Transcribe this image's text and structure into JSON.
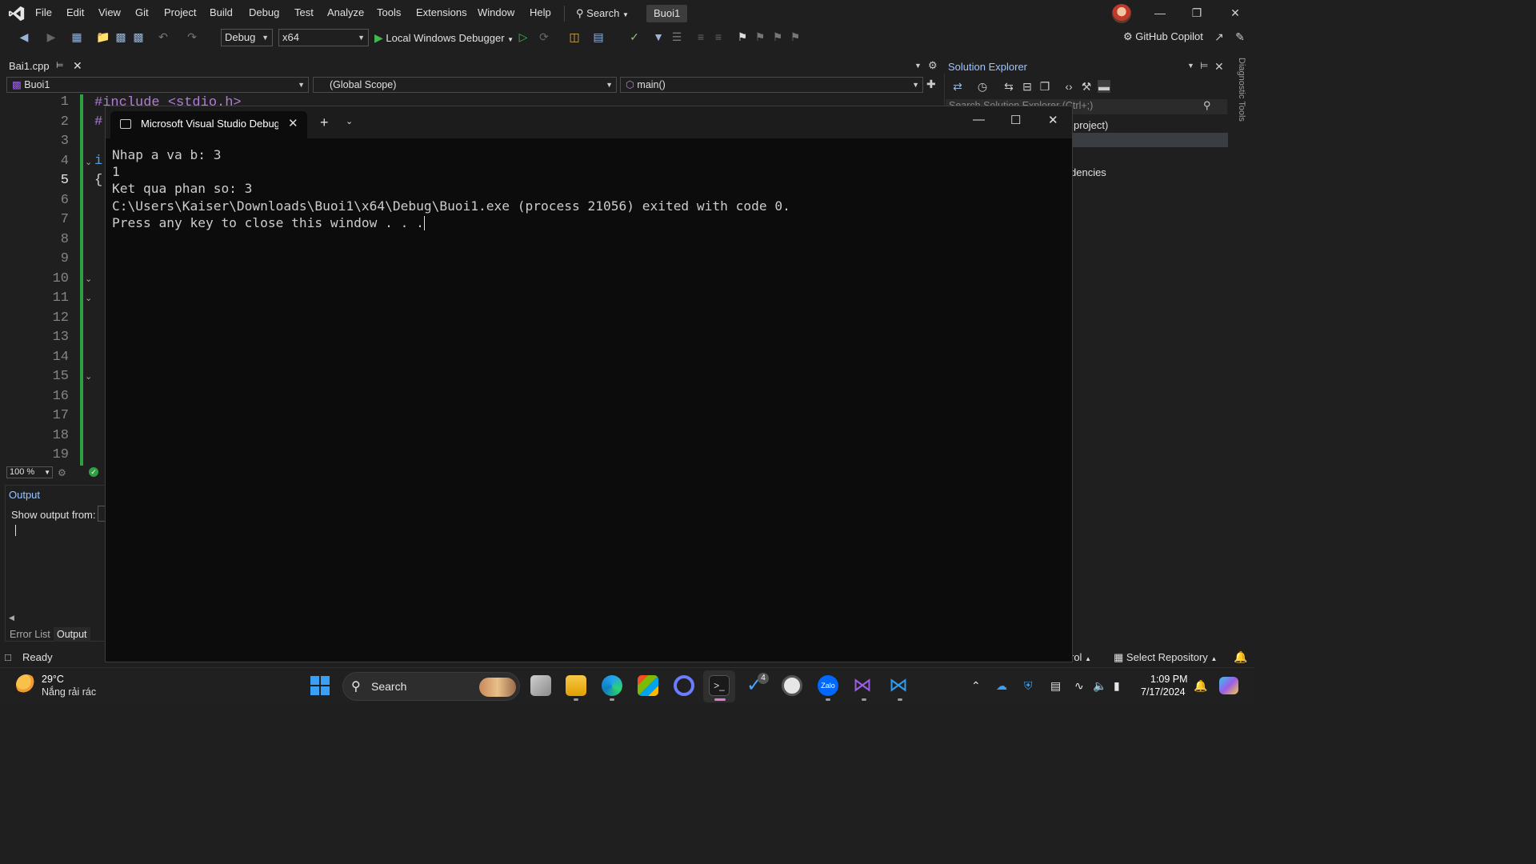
{
  "menubar": {
    "items": [
      "File",
      "Edit",
      "View",
      "Git",
      "Project",
      "Build",
      "Debug",
      "Test",
      "Analyze",
      "Tools",
      "Extensions",
      "Window",
      "Help"
    ],
    "search_label": "Search",
    "solution_name": "Buoi1"
  },
  "toolbar": {
    "configuration": "Debug",
    "platform": "x64",
    "debugger_label": "Local Windows Debugger",
    "copilot_label": "GitHub Copilot"
  },
  "editor": {
    "tab_label": "Bai1.cpp",
    "project_combo": "Buoi1",
    "scope_combo": "(Global Scope)",
    "member_combo": "main()",
    "line_numbers": [
      "1",
      "2",
      "3",
      "4",
      "5",
      "6",
      "7",
      "8",
      "9",
      "10",
      "11",
      "12",
      "13",
      "14",
      "15",
      "16",
      "17",
      "18",
      "19"
    ],
    "code_line1": "#include <stdio.h>",
    "code_line2": "#",
    "code_line4": "i",
    "code_line5": "{",
    "zoom": "100 %"
  },
  "output": {
    "title": "Output",
    "show_from_label": "Show output from:",
    "tabs": [
      "Error List",
      "Output"
    ]
  },
  "solution_explorer": {
    "title": "Solution Explorer",
    "search_fragment": "Search Solution Explorer (Ctrl+;)",
    "project_fragment": "project)",
    "dependencies_fragment": "dencies",
    "side_tab": "Diagnostic Tools"
  },
  "statusbar": {
    "ready": "Ready",
    "source_control_fragment": "rol",
    "repo": "Select Repository"
  },
  "console": {
    "tab_title": "Microsoft Visual Studio Debug Console",
    "lines": [
      "Nhap a va b: 3",
      "1",
      "Ket qua phan so: 3",
      "C:\\Users\\Kaiser\\Downloads\\Buoi1\\x64\\Debug\\Buoi1.exe (process 21056) exited with code 0.",
      "Press any key to close this window . . ."
    ]
  },
  "taskbar": {
    "weather_temp": "29°C",
    "weather_desc": "Nắng rải rác",
    "search_label": "Search",
    "notification_badge": "4",
    "zalo_label": "Zalo",
    "time": "1:09 PM",
    "date": "7/17/2024"
  },
  "colors": {
    "accent_blue": "#3aa0f5",
    "vs_purple": "#9b5de5",
    "change_bar_green": "#2ea043"
  }
}
